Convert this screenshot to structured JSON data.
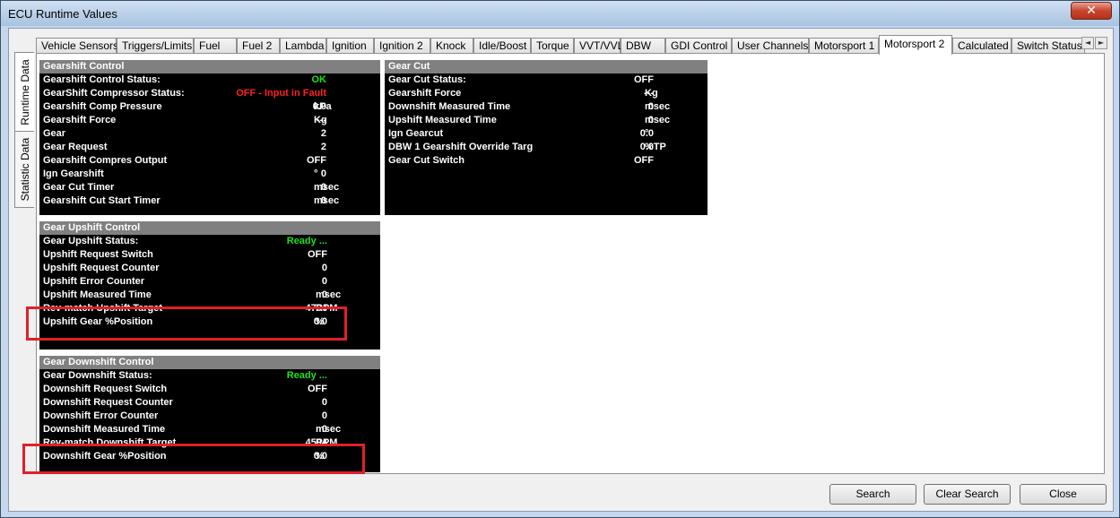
{
  "window": {
    "title": "ECU Runtime Values",
    "close_glyph": "✕"
  },
  "side_tabs": [
    "Runtime Data",
    "Statistic Data"
  ],
  "tabs": [
    "Vehicle Sensors",
    "Triggers/Limits",
    "Fuel",
    "Fuel 2",
    "Lambda",
    "Ignition",
    "Ignition 2",
    "Knock",
    "Idle/Boost",
    "Torque",
    "VVT/VVL",
    "DBW",
    "GDI Control",
    "User Channels",
    "Motorsport 1",
    "Motorsport 2",
    "Calculated",
    "Switch Status"
  ],
  "active_tab": "Motorsport 2",
  "scroll": {
    "left": "◄",
    "right": "►"
  },
  "panels": {
    "gearshift": {
      "title": "Gearshift Control",
      "rows": [
        {
          "label": "Gearshift Control Status:",
          "value": "OK",
          "unit": "",
          "color": "green"
        },
        {
          "label": "GearShift Compressor Status:",
          "value": "OFF -  Input in Fault",
          "unit": "",
          "color": "red"
        },
        {
          "label": "Gearshift Comp Pressure",
          "value": "0.0",
          "unit": "kPa",
          "color": ""
        },
        {
          "label": "Gearshift Force",
          "value": "---",
          "unit": "Kg",
          "color": ""
        },
        {
          "label": "Gear",
          "value": "2",
          "unit": "",
          "color": ""
        },
        {
          "label": "Gear Request",
          "value": "2",
          "unit": "",
          "color": ""
        },
        {
          "label": "Gearshift Compres Output",
          "value": "OFF",
          "unit": "",
          "color": ""
        },
        {
          "label": "Ign Gearshift",
          "value": "0",
          "unit": "°",
          "color": ""
        },
        {
          "label": "Gear Cut Timer",
          "value": "0",
          "unit": "msec",
          "color": ""
        },
        {
          "label": "Gearshift Cut Start Timer",
          "value": "0",
          "unit": "msec",
          "color": ""
        }
      ]
    },
    "gearcut": {
      "title": "Gear Cut",
      "rows": [
        {
          "label": "Gear Cut Status:",
          "value": "OFF",
          "unit": "",
          "color": ""
        },
        {
          "label": "Gearshift Force",
          "value": "---",
          "unit": "Kg",
          "color": ""
        },
        {
          "label": "Downshift Measured Time",
          "value": "0",
          "unit": "msec",
          "color": ""
        },
        {
          "label": "Upshift Measured Time",
          "value": "0",
          "unit": "msec",
          "color": ""
        },
        {
          "label": "Ign Gearcut",
          "value": "0.0",
          "unit": "°",
          "color": ""
        },
        {
          "label": "DBW 1 Gearshift Override Targ",
          "value": "0.0",
          "unit": "%TP",
          "color": ""
        },
        {
          "label": "Gear Cut Switch",
          "value": "OFF",
          "unit": "",
          "color": ""
        }
      ]
    },
    "upshift": {
      "title": "Gear Upshift Control",
      "rows": [
        {
          "label": "Gear Upshift Status:",
          "value": "Ready ...",
          "unit": "",
          "color": "green"
        },
        {
          "label": "Upshift Request Switch",
          "value": "OFF",
          "unit": "",
          "color": ""
        },
        {
          "label": "Upshift Request Counter",
          "value": "0",
          "unit": "",
          "color": ""
        },
        {
          "label": "Upshift Error Counter",
          "value": "0",
          "unit": "",
          "color": ""
        },
        {
          "label": "Upshift Measured Time",
          "value": "0",
          "unit": "msec",
          "color": ""
        },
        {
          "label": "Rev-match Upshift Target",
          "value": "4704",
          "unit": "RPM",
          "color": ""
        },
        {
          "label": "Upshift Gear %Position",
          "value": "0.0",
          "unit": "%",
          "color": ""
        }
      ]
    },
    "downshift": {
      "title": "Gear Downshift Control",
      "rows": [
        {
          "label": "Gear Downshift Status:",
          "value": "Ready ...",
          "unit": "",
          "color": "green"
        },
        {
          "label": "Downshift Request Switch",
          "value": "OFF",
          "unit": "",
          "color": ""
        },
        {
          "label": "Downshift Request Counter",
          "value": "0",
          "unit": "",
          "color": ""
        },
        {
          "label": "Downshift Error Counter",
          "value": "0",
          "unit": "",
          "color": ""
        },
        {
          "label": "Downshift Measured Time",
          "value": "0",
          "unit": "msec",
          "color": ""
        },
        {
          "label": "Rev-match Downshift Target",
          "value": "4504",
          "unit": "RPM",
          "color": ""
        },
        {
          "label": "Downshift Gear %Position",
          "value": "0.0",
          "unit": "%",
          "color": ""
        }
      ]
    }
  },
  "buttons": {
    "search": "Search",
    "clear_search": "Clear Search",
    "close": "Close"
  },
  "colors": {
    "highlight": "#e0202a",
    "status_ok": "#1ee01e",
    "status_fault": "#ff2020"
  }
}
